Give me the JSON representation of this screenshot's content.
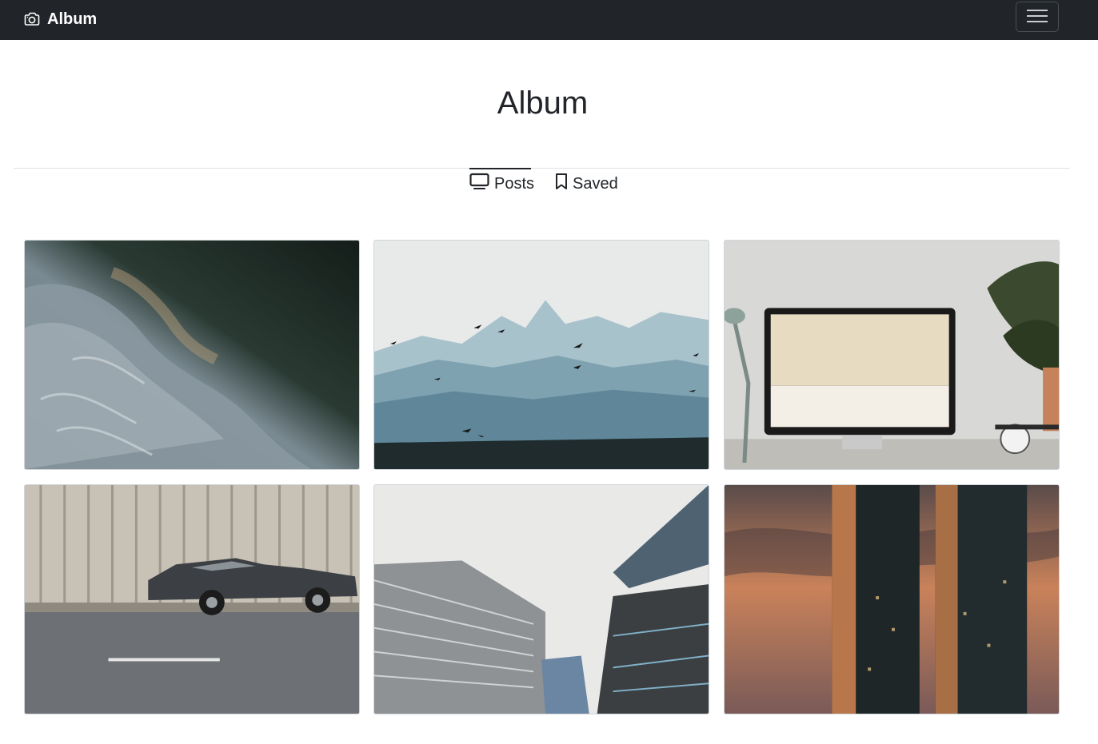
{
  "navbar": {
    "brand_label": "Album",
    "brand_icon": "camera-icon",
    "menu_icon": "hamburger-icon"
  },
  "header": {
    "title": "Album"
  },
  "tabs": [
    {
      "label": "Posts",
      "icon": "tv-icon",
      "active": true
    },
    {
      "label": "Saved",
      "icon": "bookmark-icon",
      "active": false
    }
  ],
  "gallery": {
    "photos": [
      {
        "subject": "aerial ocean waves"
      },
      {
        "subject": "misty mountains with birds"
      },
      {
        "subject": "monitor on desk with plant"
      },
      {
        "subject": "vintage car by metal wall"
      },
      {
        "subject": "skyscrapers looking up"
      },
      {
        "subject": "twin towers at sunset"
      }
    ]
  },
  "colors": {
    "navbar_bg": "#212529",
    "text": "#212529",
    "divider": "#dee2e6"
  }
}
